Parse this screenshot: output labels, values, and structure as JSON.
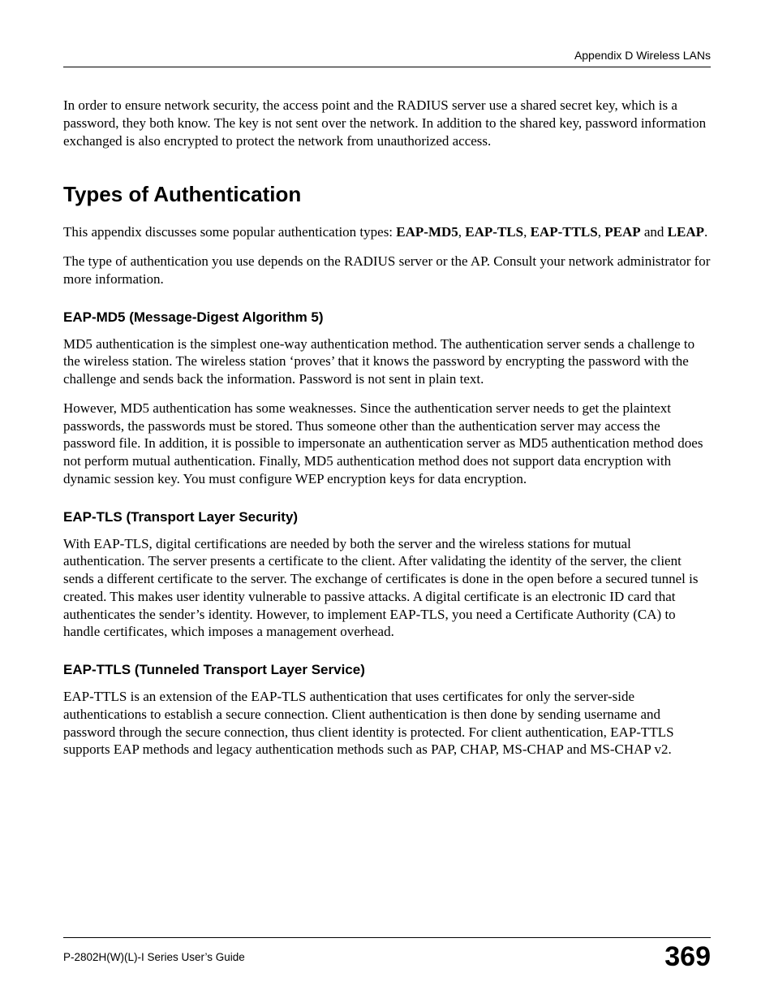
{
  "header": {
    "appendix_label": "Appendix D Wireless LANs"
  },
  "intro": {
    "p1": "In order to ensure network security, the access point and the RADIUS server use a shared secret key, which is a password, they both know. The key is not sent over the network. In addition to the shared key, password information exchanged is also encrypted to protect the network from unauthorized access."
  },
  "section": {
    "title": "Types of Authentication",
    "p1_prefix": "This appendix discusses some popular authentication types: ",
    "types": {
      "t1": "EAP-MD5",
      "t2": "EAP-TLS",
      "t3": "EAP-TTLS",
      "t4": "PEAP",
      "t5": "LEAP"
    },
    "p2": "The type of authentication you use depends on the RADIUS server or the AP. Consult your network administrator for more information."
  },
  "md5": {
    "heading": "EAP-MD5 (Message-Digest Algorithm 5)",
    "p1": "MD5 authentication is the simplest one-way authentication method. The authentication server sends a challenge to the wireless station. The wireless station ‘proves’ that it knows the password by encrypting the password with the challenge and sends back the information. Password is not sent in plain text.",
    "p2": "However, MD5 authentication has some weaknesses. Since the authentication server needs to get the plaintext passwords, the passwords must be stored. Thus someone other than the authentication server may access the password file. In addition, it is possible to impersonate an authentication server as MD5 authentication method does not perform mutual authentication. Finally, MD5 authentication method does not support data encryption with dynamic session key. You must configure WEP encryption keys for data encryption."
  },
  "tls": {
    "heading": "EAP-TLS (Transport Layer Security)",
    "p1": "With EAP-TLS, digital certifications are needed by both the server and the wireless stations for mutual authentication. The server presents a certificate to the client. After validating the identity of the server, the client sends a different certificate to the server. The exchange of certificates is done in the open before a secured tunnel is created. This makes user identity vulnerable to passive attacks. A digital certificate is an electronic ID card that authenticates the sender’s identity. However, to implement EAP-TLS, you need a Certificate Authority (CA) to handle certificates, which imposes a management overhead."
  },
  "ttls": {
    "heading": "EAP-TTLS (Tunneled Transport Layer Service)",
    "p1": "EAP-TTLS is an extension of the EAP-TLS authentication that uses certificates for only the server-side authentications to establish a secure connection. Client authentication is then done by sending username and password through the secure connection, thus client identity is protected. For client authentication, EAP-TTLS supports EAP methods and legacy authentication methods such as PAP, CHAP, MS-CHAP and MS-CHAP v2."
  },
  "footer": {
    "guide_title": "P-2802H(W)(L)-I Series User’s Guide",
    "page_number": "369"
  }
}
